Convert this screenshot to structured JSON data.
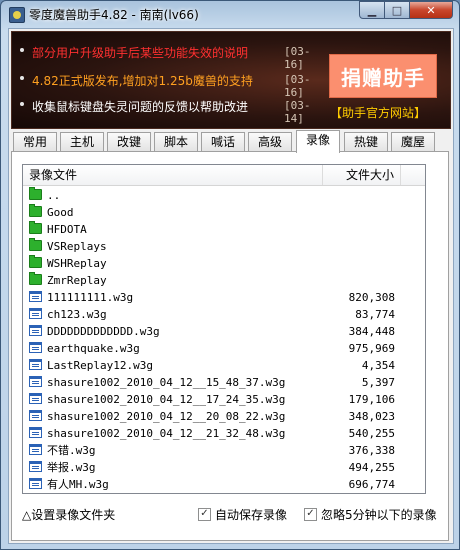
{
  "window": {
    "title": "零度魔兽助手4.82 - 南南(lv66)"
  },
  "banner": {
    "news": [
      {
        "text": "部分用户升级助手后某些功能失效的说明",
        "date": "[03-16]"
      },
      {
        "text": "4.82正式版发布,增加对1.25b魔兽的支持",
        "date": "[03-16]"
      },
      {
        "text": "收集鼠标键盘失灵问题的反馈以帮助改进",
        "date": "[03-14]"
      }
    ],
    "donate_label": "捐赠助手",
    "official_link": "【助手官方网站】"
  },
  "tabs": [
    "常用",
    "主机",
    "改键",
    "脚本",
    "喊话",
    "高级",
    "录像",
    "热键",
    "魔屋"
  ],
  "active_tab": "录像",
  "list": {
    "col_name": "录像文件",
    "col_size": "文件大小",
    "rows": [
      {
        "type": "folder",
        "name": "..",
        "size": ""
      },
      {
        "type": "folder",
        "name": "Good",
        "size": ""
      },
      {
        "type": "folder",
        "name": "HFDOTA",
        "size": ""
      },
      {
        "type": "folder",
        "name": "VSReplays",
        "size": ""
      },
      {
        "type": "folder",
        "name": "WSHReplay",
        "size": ""
      },
      {
        "type": "folder",
        "name": "ZmrReplay",
        "size": ""
      },
      {
        "type": "file",
        "name": "111111111.w3g",
        "size": "820,308"
      },
      {
        "type": "file",
        "name": "ch123.w3g",
        "size": "83,774"
      },
      {
        "type": "file",
        "name": "DDDDDDDDDDDDD.w3g",
        "size": "384,448"
      },
      {
        "type": "file",
        "name": "earthquake.w3g",
        "size": "975,969"
      },
      {
        "type": "file",
        "name": "LastReplay12.w3g",
        "size": "4,354"
      },
      {
        "type": "file",
        "name": "shasure1002_2010_04_12__15_48_37.w3g",
        "size": "5,397"
      },
      {
        "type": "file",
        "name": "shasure1002_2010_04_12__17_24_35.w3g",
        "size": "179,106"
      },
      {
        "type": "file",
        "name": "shasure1002_2010_04_12__20_08_22.w3g",
        "size": "348,023"
      },
      {
        "type": "file",
        "name": "shasure1002_2010_04_12__21_32_48.w3g",
        "size": "540,255"
      },
      {
        "type": "file",
        "name": "不错.w3g",
        "size": "376,338"
      },
      {
        "type": "file",
        "name": "举报.w3g",
        "size": "494,255"
      },
      {
        "type": "file",
        "name": "有人MH.w3g",
        "size": "696,774"
      }
    ]
  },
  "footer": {
    "set_dir": "△设置录像文件夹",
    "auto_save": "自动保存录像",
    "ignore_short": "忽略5分钟以下的录像",
    "auto_save_checked": true,
    "ignore_short_checked": true
  }
}
